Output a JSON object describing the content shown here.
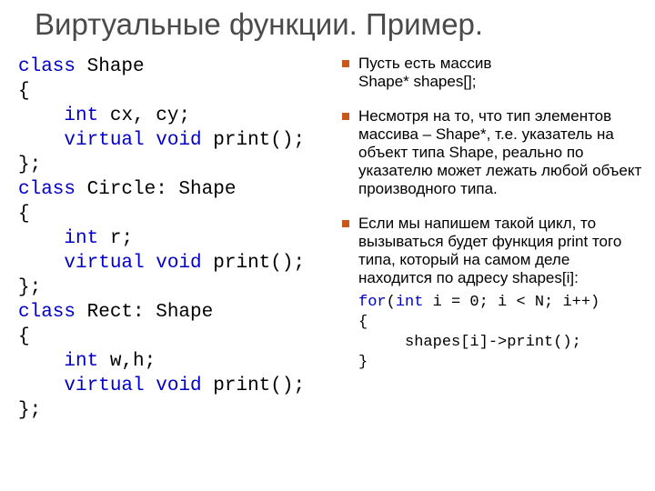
{
  "title": "Виртуальные функции. Пример.",
  "code_left": {
    "l1a": "class",
    "l1b": " Shape",
    "l2": "{",
    "l3a": "    ",
    "l3b": "int",
    "l3c": " cx, cy;",
    "l4a": "    ",
    "l4b": "virtual",
    "l4c": " ",
    "l4d": "void",
    "l4e": " print();",
    "l5": "};",
    "l6a": "class",
    "l6b": " Circle: Shape",
    "l7": "{",
    "l8a": "    ",
    "l8b": "int",
    "l8c": " r;",
    "l9a": "    ",
    "l9b": "virtual",
    "l9c": " ",
    "l9d": "void",
    "l9e": " print();",
    "l10": "};",
    "l11a": "class",
    "l11b": " Rect: Shape",
    "l12": "{",
    "l13a": "    ",
    "l13b": "int",
    "l13c": " w,h;",
    "l14a": "    ",
    "l14b": "virtual",
    "l14c": " ",
    "l14d": "void",
    "l14e": " print();",
    "l15": "};"
  },
  "bullets": {
    "b1_line1": "Пусть есть массив",
    "b1_line2": "Shape* shapes[];",
    "b2": "Несмотря на то, что тип элементов массива – Shape*, т.е. указатель на объект типа Shape, реально по указателю может лежать любой объект производного типа.",
    "b3": "Если мы напишем такой цикл, то вызываться будет функция print того типа, который на самом деле находится по адресу shapes[i]:"
  },
  "code_right": {
    "l1a": "for",
    "l1b": "(",
    "l1c": "int",
    "l1d": " i = 0; i < N; i++)",
    "l2": "{",
    "l3": "     shapes[i]->print();",
    "l4": "}"
  }
}
